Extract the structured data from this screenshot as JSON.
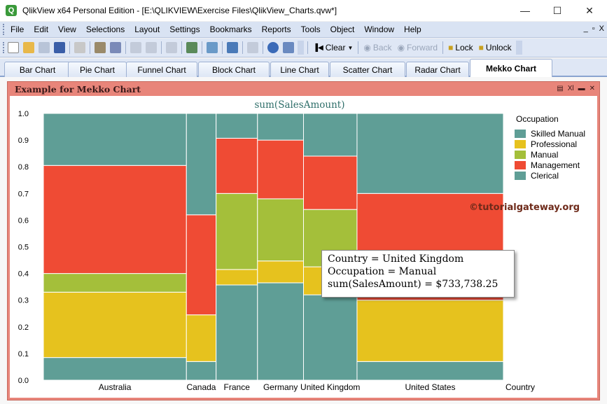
{
  "window": {
    "title": "QlikView x64 Personal Edition - [E:\\QLIKVIEW\\Exercise Files\\QlikView_Charts.qvw*]",
    "icon": "qlikview-logo-icon",
    "minimize": "—",
    "maximize": "☐",
    "close": "✕"
  },
  "menu": {
    "items": [
      "File",
      "Edit",
      "View",
      "Selections",
      "Layout",
      "Settings",
      "Bookmarks",
      "Reports",
      "Tools",
      "Object",
      "Window",
      "Help"
    ],
    "mdi_min": "_",
    "mdi_restore": "▫",
    "mdi_close": "X"
  },
  "toolbar": {
    "clear_label": "Clear",
    "back_label": "Back",
    "forward_label": "Forward",
    "lock_label": "Lock",
    "unlock_label": "Unlock"
  },
  "tabs": [
    "Bar Chart",
    "Pie Chart",
    "Funnel Chart",
    "Block Chart",
    "Line Chart",
    "Scatter Chart",
    "Radar Chart",
    "Mekko Chart"
  ],
  "active_tab": "Mekko Chart",
  "chart_object": {
    "caption": "Example for Mekko Chart",
    "caption_icons": [
      "print-icon",
      "xl-icon",
      "minimize-icon",
      "close-icon"
    ],
    "caption_xl": "Xl",
    "frame_color": "#e8857a"
  },
  "chart_data": {
    "type": "mekko",
    "title": "sum(SalesAmount)",
    "xlabel": "Country",
    "ylim": [
      0,
      1
    ],
    "yticks": [
      "0.0",
      "0.1",
      "0.2",
      "0.3",
      "0.4",
      "0.5",
      "0.6",
      "0.7",
      "0.8",
      "0.9",
      "1.0"
    ],
    "legend_title": "Occupation",
    "legend_position": "right",
    "series": [
      {
        "name": "Skilled Manual",
        "color": "#5f9e96"
      },
      {
        "name": "Professional",
        "color": "#e6c21e"
      },
      {
        "name": "Manual",
        "color": "#a4bf3a"
      },
      {
        "name": "Management",
        "color": "#ef4b34"
      },
      {
        "name": "Clerical",
        "color": "#5f9e96"
      }
    ],
    "categories": [
      {
        "name": "Australia",
        "width": 0.342,
        "stacks": [
          0.085,
          0.245,
          0.07,
          0.405,
          0.195
        ]
      },
      {
        "name": "Canada",
        "width": 0.071,
        "stacks": [
          0.07,
          0.175,
          0.0,
          0.375,
          0.38
        ]
      },
      {
        "name": "France",
        "width": 0.099,
        "stacks": [
          0.357,
          0.058,
          0.285,
          0.207,
          0.093
        ]
      },
      {
        "name": "Germany",
        "width": 0.11,
        "stacks": [
          0.365,
          0.082,
          0.233,
          0.22,
          0.1
        ]
      },
      {
        "name": "United Kingdom",
        "width": 0.128,
        "stacks": [
          0.32,
          0.105,
          0.215,
          0.2,
          0.16
        ]
      },
      {
        "name": "United States",
        "width": 0.35,
        "stacks": [
          0.07,
          0.23,
          0.0,
          0.4,
          0.3
        ]
      }
    ],
    "watermark": "©tutorialgateway.org"
  },
  "tooltip": {
    "line1": "Country = United Kingdom",
    "line2": "Occupation = Manual",
    "line3": "sum(SalesAmount) = $733,738.25"
  }
}
